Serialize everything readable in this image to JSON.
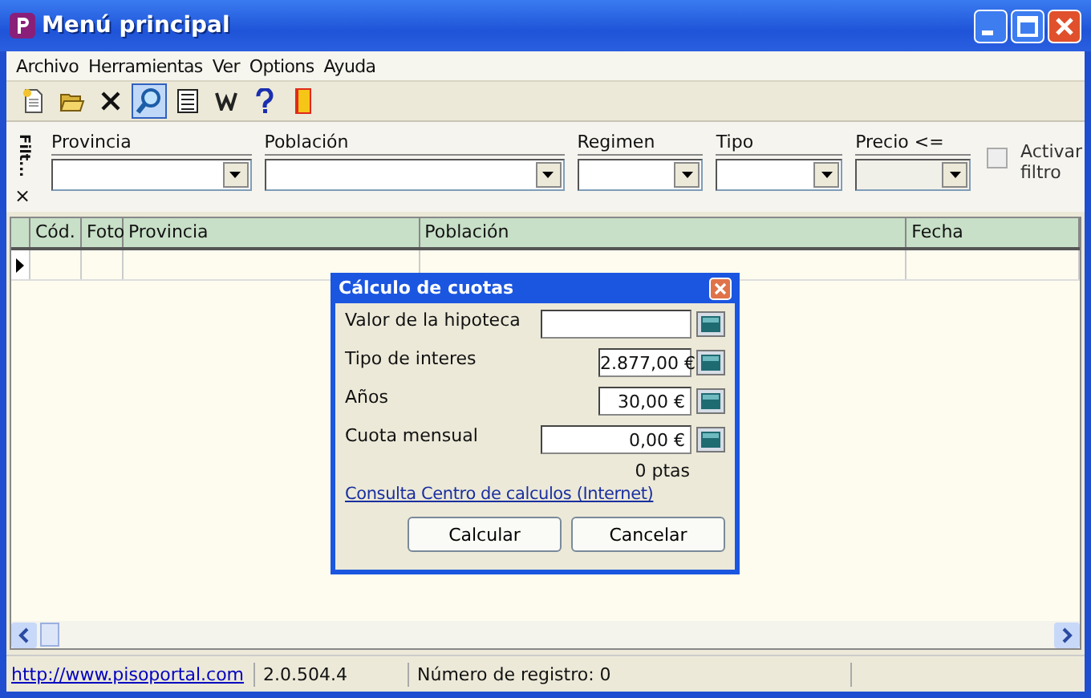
{
  "window": {
    "title": "Menú principal"
  },
  "menu": [
    "Archivo",
    "Herramientas",
    "Ver",
    "Options",
    "Ayuda"
  ],
  "toolbar": [
    {
      "kind": "new",
      "selected": false
    },
    {
      "kind": "open",
      "selected": false
    },
    {
      "kind": "delete",
      "selected": false
    },
    {
      "kind": "search",
      "selected": true
    },
    {
      "kind": "list",
      "selected": false
    },
    {
      "kind": "word",
      "selected": false
    },
    {
      "kind": "help",
      "selected": false
    },
    {
      "kind": "exit",
      "selected": false
    }
  ],
  "filter": {
    "label": "Filt...",
    "close": "×",
    "fields": [
      {
        "label": "Provincia",
        "disabled": false
      },
      {
        "label": "Población",
        "disabled": false
      },
      {
        "label": "Regimen",
        "disabled": false
      },
      {
        "label": "Tipo",
        "disabled": false
      },
      {
        "label": "Precio <=",
        "disabled": true
      }
    ],
    "checkbox": {
      "label": "Activar filtro",
      "checked": false
    }
  },
  "table": {
    "columns": [
      "Cód.",
      "Foto",
      "Provincia",
      "Población",
      "Fecha"
    ]
  },
  "dialog": {
    "title": "Cálculo de cuotas",
    "fields": [
      {
        "label": "Valor de la hipoteca"
      },
      {
        "label": "Tipo de interes",
        "value": "2.877,00 €"
      },
      {
        "label": "Años",
        "value": "30,00 €"
      },
      {
        "label": "Cuota mensual",
        "value": "0,00 €"
      }
    ],
    "pesetas": "0 ptas",
    "link": "Consulta Centro de calculos (Internet)",
    "buttons": [
      "Calcular",
      "Cancelar"
    ]
  },
  "status_bar": {
    "link": "http://www.pisoportal.com",
    "version": "2.0.504.4",
    "record": "Número de registro: 0"
  }
}
